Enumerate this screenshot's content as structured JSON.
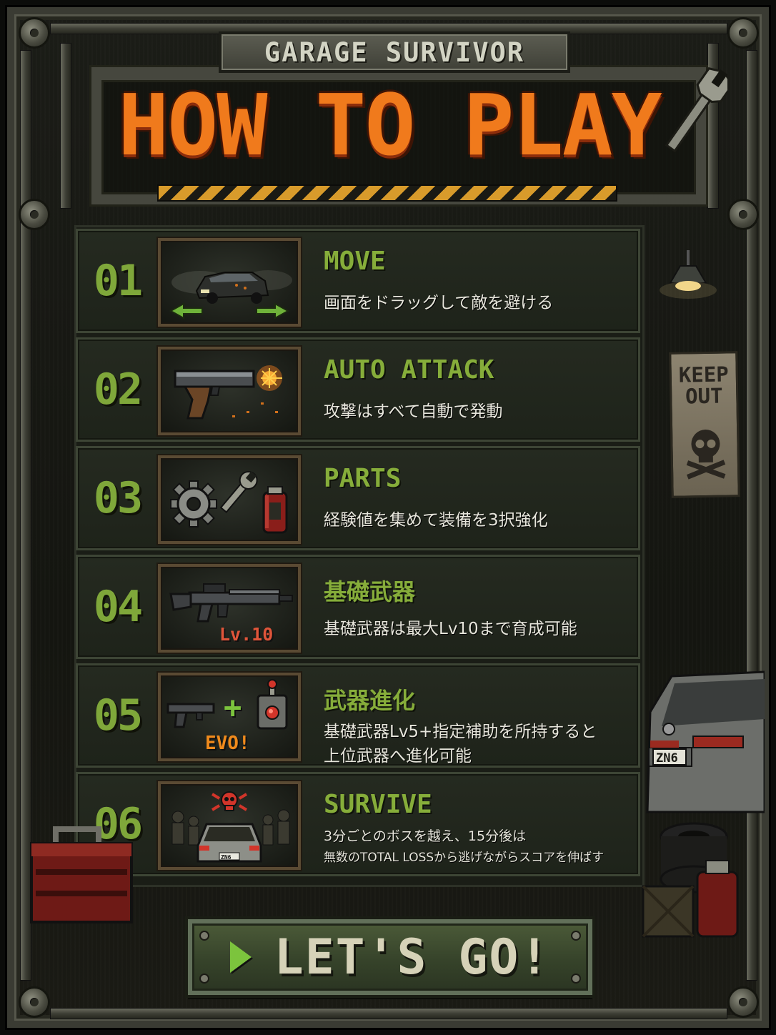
{
  "header": {
    "subtitle": "GARAGE SURVIVOR",
    "title": "HOW TO PLAY"
  },
  "steps": [
    {
      "number": "01",
      "title": "MOVE",
      "description": "画面をドラッグして敵を避ける",
      "icon": "car-with-arrows-icon"
    },
    {
      "number": "02",
      "title": "AUTO ATTACK",
      "description": "攻撃はすべて自動で発動",
      "icon": "pistol-icon"
    },
    {
      "number": "03",
      "title": "PARTS",
      "description": "経験値を集めて装備を3択強化",
      "icon": "gear-wrench-canister-icon"
    },
    {
      "number": "04",
      "title": "基礎武器",
      "description": "基礎武器は最大Lv10まで育成可能",
      "icon": "rifle-icon",
      "badge": "Lv.10"
    },
    {
      "number": "05",
      "title": "武器進化",
      "description_lines": [
        "基礎武器Lv5+指定補助を所持すると",
        "上位武器へ進化可能"
      ],
      "icon": "weapon-evolution-icon",
      "badge": "EVO!",
      "plus": "+"
    },
    {
      "number": "06",
      "title": "SURVIVE",
      "description_lines": [
        "3分ごとのボスを越え、15分後は",
        "無数のTOTAL LOSSから逃げながらスコアを伸ばす"
      ],
      "icon": "car-surrounded-skull-icon",
      "plate": "ZN6"
    }
  ],
  "scene": {
    "keep_out_sign": [
      "KEEP",
      "OUT"
    ],
    "car_plate": "ZN6"
  },
  "button": {
    "label": "LET'S GO!"
  },
  "colors": {
    "accent_green": "#86ad3a",
    "title_orange": "#f07a1c",
    "button_arrow": "#7cc43d"
  }
}
